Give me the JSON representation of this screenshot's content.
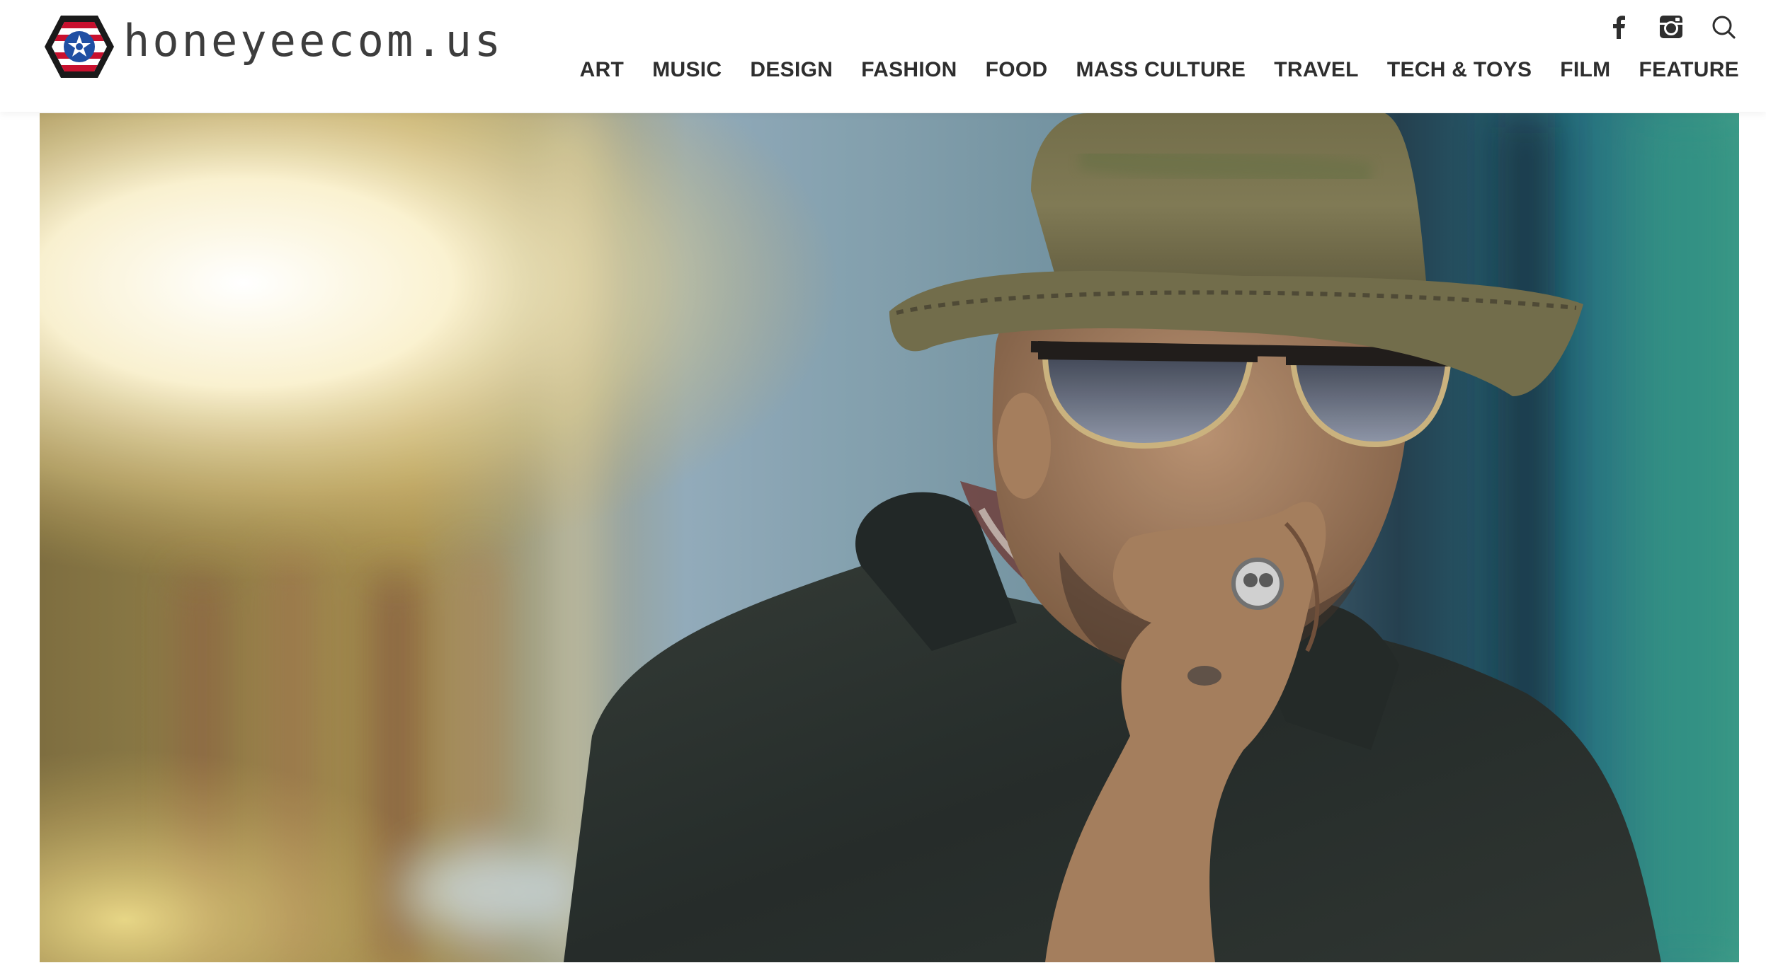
{
  "site": {
    "logo_text": "honeyeecom.us",
    "logo_icon": "hexagon-star-logo"
  },
  "social": {
    "facebook_icon": "facebook-icon",
    "instagram_icon": "instagram-icon",
    "search_icon": "search-icon"
  },
  "nav": {
    "items": [
      {
        "label": "ART"
      },
      {
        "label": "MUSIC"
      },
      {
        "label": "DESIGN"
      },
      {
        "label": "FASHION"
      },
      {
        "label": "FOOD"
      },
      {
        "label": "MASS CULTURE"
      },
      {
        "label": "TRAVEL"
      },
      {
        "label": "TECH & TOYS"
      },
      {
        "label": "FILM"
      },
      {
        "label": "FEATURE"
      }
    ]
  },
  "hero": {
    "image_subject": "man-in-hat-and-sunglasses-photo"
  },
  "colors": {
    "text": "#2e2e2e",
    "logo_red": "#c8102e",
    "logo_blue": "#1f4fa3"
  }
}
